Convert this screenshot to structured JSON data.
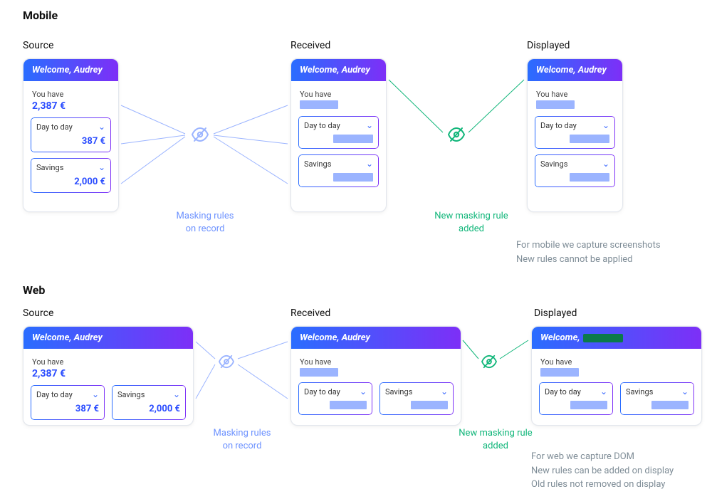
{
  "sections": {
    "mobile": {
      "title": "Mobile"
    },
    "web": {
      "title": "Web"
    }
  },
  "columns": {
    "source": "Source",
    "received": "Received",
    "displayed": "Displayed"
  },
  "source_card": {
    "header": "Welcome, Audrey",
    "you_have_label": "You have",
    "total": "2,387 €",
    "accounts": [
      {
        "name": "Day to day",
        "value": "387 €"
      },
      {
        "name": "Savings",
        "value": "2,000 €"
      }
    ]
  },
  "received_card": {
    "header": "Welcome, Audrey",
    "you_have_label": "You have",
    "accounts": [
      {
        "name": "Day to day"
      },
      {
        "name": "Savings"
      }
    ]
  },
  "displayed_card": {
    "header": "Welcome, Audrey",
    "you_have_label": "You have",
    "accounts": [
      {
        "name": "Day to day"
      },
      {
        "name": "Savings"
      }
    ]
  },
  "web_displayed_header_prefix": "Welcome,",
  "captions": {
    "on_record": "Masking rules\non record",
    "new_rule": "New masking rule\nadded"
  },
  "annotations": {
    "mobile": "For mobile we capture screenshots\nNew rules cannot be applied",
    "web": "For web we capture DOM\nNew rules can be added on display\nOld rules not removed on display"
  }
}
